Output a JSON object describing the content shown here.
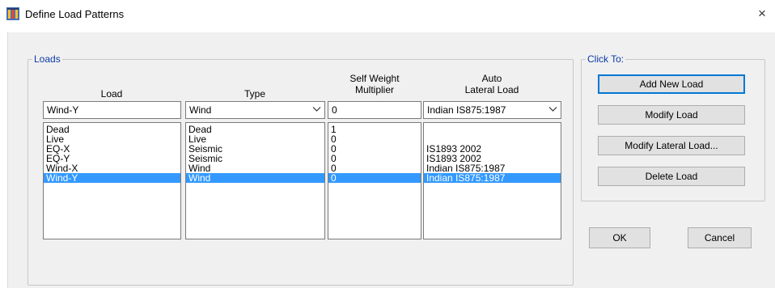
{
  "window": {
    "title": "Define Load Patterns",
    "close_glyph": "×"
  },
  "loads_group": {
    "legend": "Loads",
    "columns": {
      "load": "Load",
      "type": "Type",
      "self_weight_line1": "Self Weight",
      "self_weight_line2": "Multiplier",
      "auto_line1": "Auto",
      "auto_line2": "Lateral Load"
    },
    "inputs": {
      "load_value": "Wind-Y",
      "type_value": "Wind",
      "multiplier_value": "0",
      "auto_value": "Indian IS875:1987"
    },
    "rows": [
      {
        "load": "Dead",
        "type": "Dead",
        "multiplier": "1",
        "auto": ""
      },
      {
        "load": "Live",
        "type": "Live",
        "multiplier": "0",
        "auto": ""
      },
      {
        "load": "EQ-X",
        "type": "Seismic",
        "multiplier": "0",
        "auto": "IS1893 2002"
      },
      {
        "load": "EQ-Y",
        "type": "Seismic",
        "multiplier": "0",
        "auto": "IS1893 2002"
      },
      {
        "load": "Wind-X",
        "type": "Wind",
        "multiplier": "0",
        "auto": "Indian IS875:1987"
      },
      {
        "load": "Wind-Y",
        "type": "Wind",
        "multiplier": "0",
        "auto": "Indian IS875:1987"
      }
    ],
    "selected_index": 5
  },
  "click_to_group": {
    "legend": "Click To:",
    "buttons": {
      "add_new": "Add New Load",
      "modify": "Modify Load",
      "modify_lateral": "Modify Lateral Load...",
      "delete": "Delete Load"
    }
  },
  "footer": {
    "ok": "OK",
    "cancel": "Cancel"
  },
  "icons": {
    "app": "load-patterns-app-icon",
    "dropdown": "chevron-down-icon",
    "close": "close-icon"
  },
  "colors": {
    "selection": "#3399ff",
    "group_label": "#0a3aa8",
    "default_button_border": "#0078d7"
  }
}
